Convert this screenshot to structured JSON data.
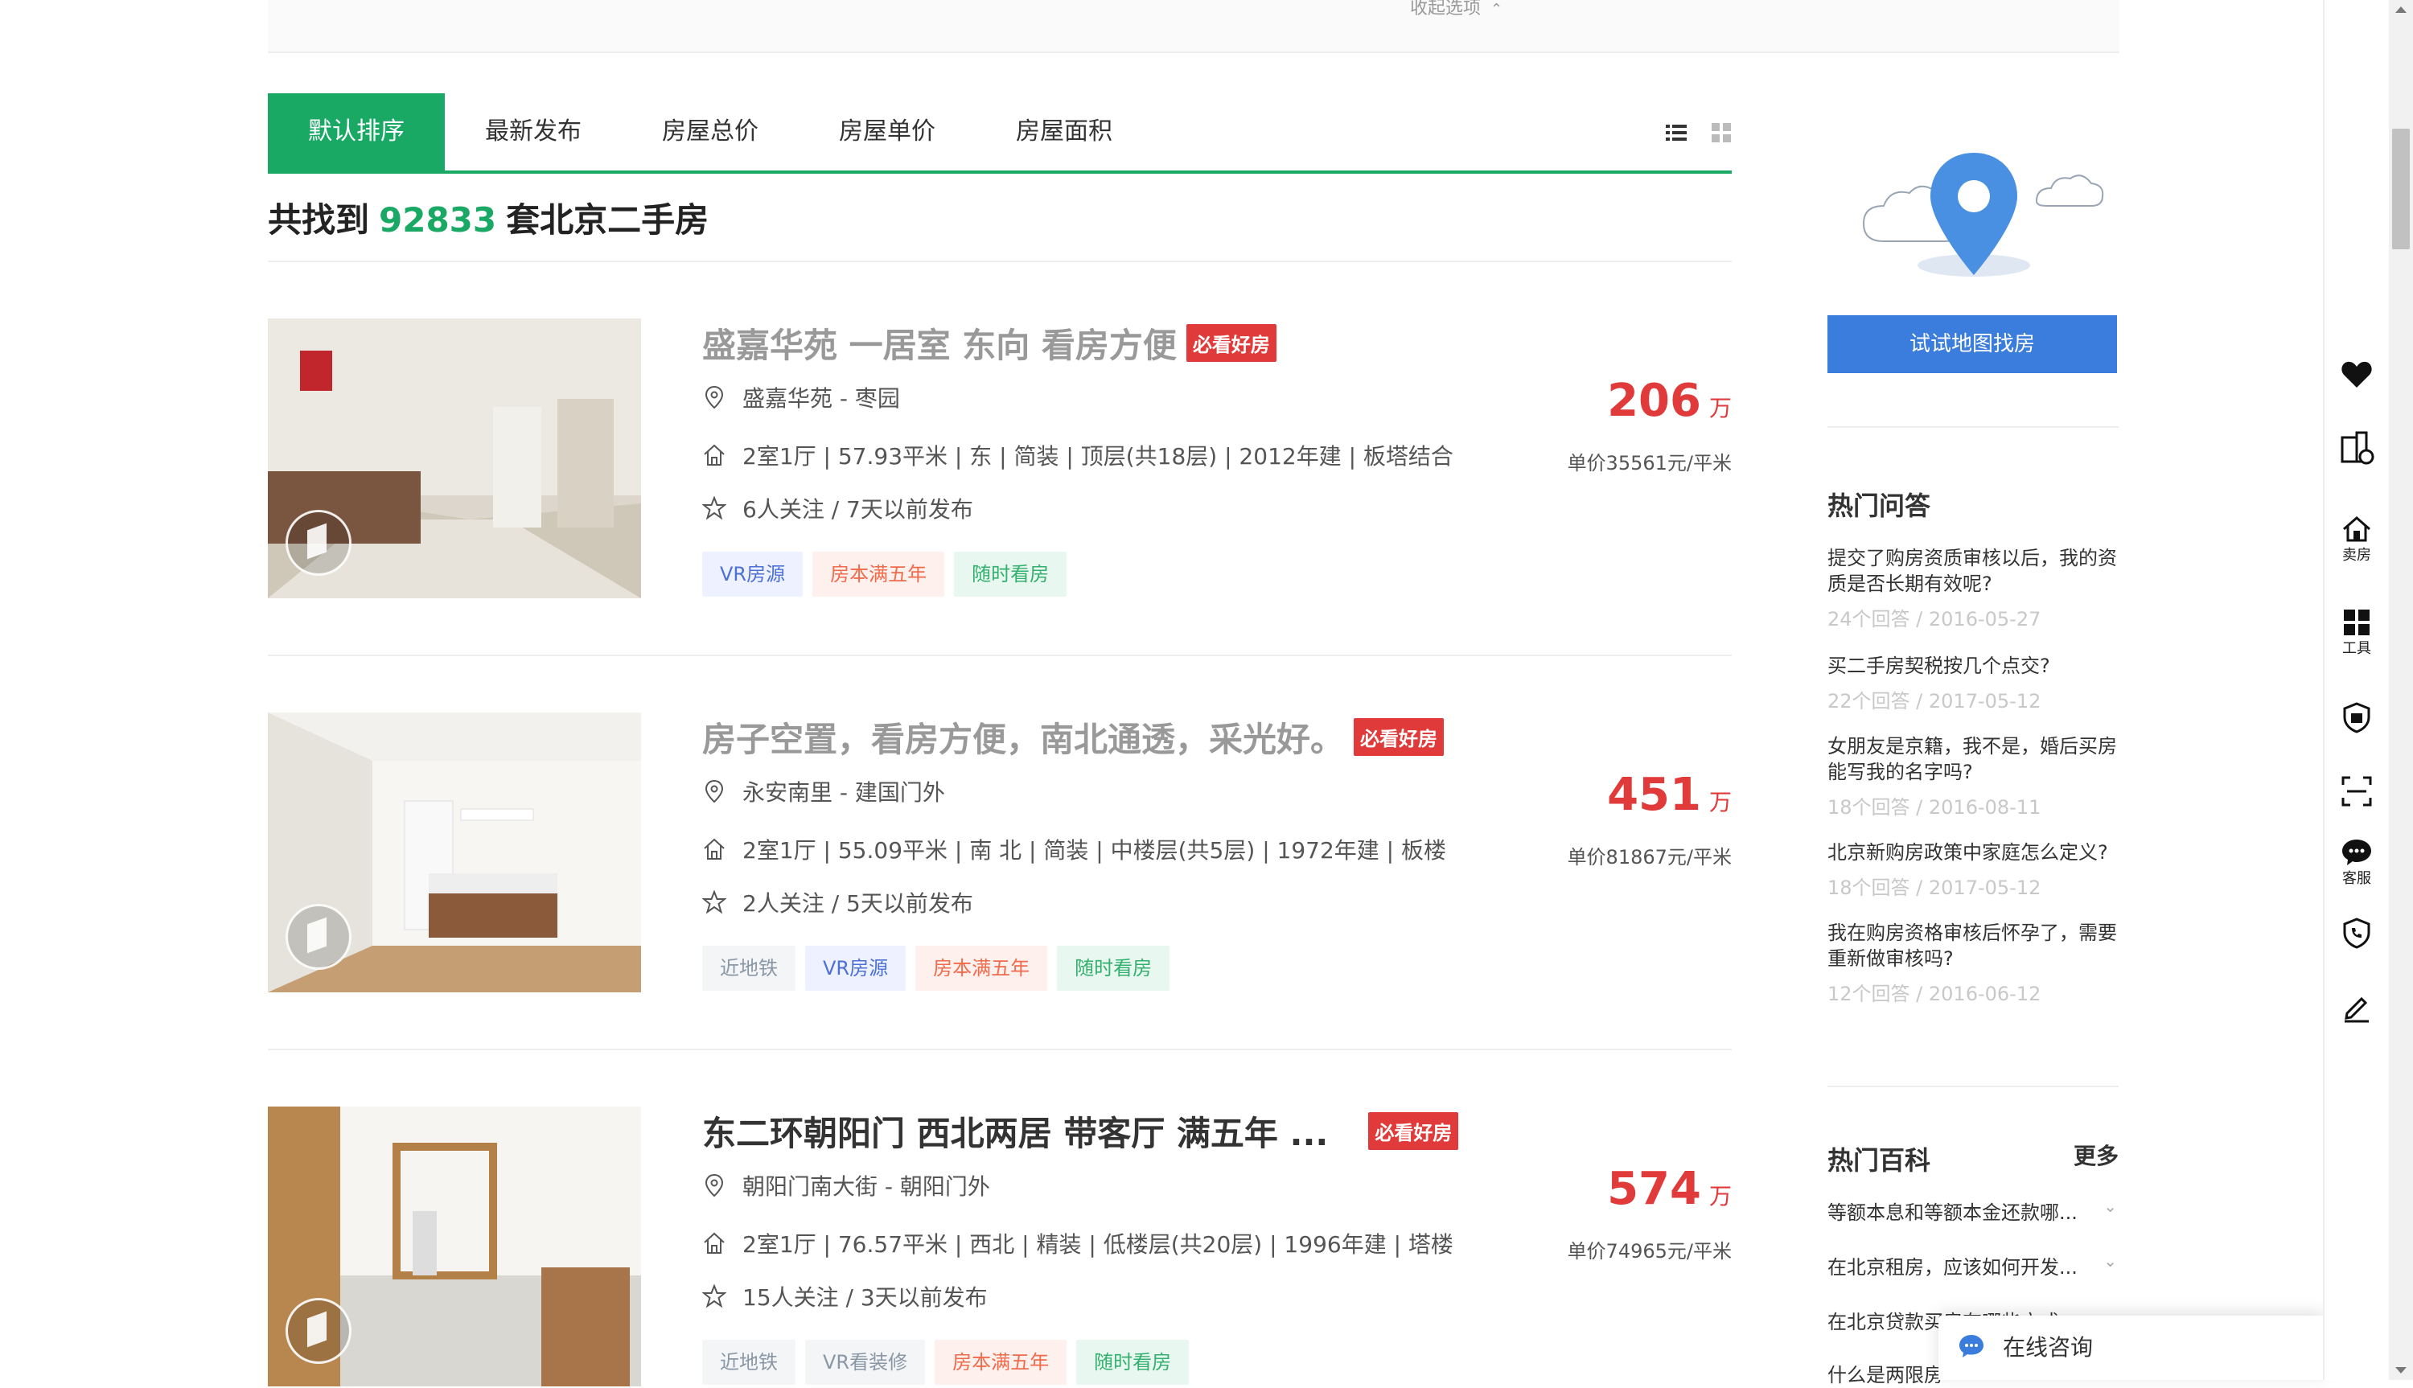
{
  "filters": {
    "collapse_label": "收起选项"
  },
  "sort_tabs": [
    {
      "label": "默认排序",
      "active": true
    },
    {
      "label": "最新发布",
      "active": false
    },
    {
      "label": "房屋总价",
      "active": false
    },
    {
      "label": "房屋单价",
      "active": false
    },
    {
      "label": "房屋面积",
      "active": false
    }
  ],
  "summary": {
    "prefix": "共找到",
    "count": "92833",
    "suffix": "套北京二手房"
  },
  "listings": [
    {
      "title": "盛嘉华苑 一居室 东向 看房方便",
      "badge": "必看好房",
      "location": "盛嘉华苑 - 枣园",
      "info": "2室1厅 | 57.93平米 | 东 | 简装 | 顶层(共18层) | 2012年建 | 板塔结合",
      "follow": "6人关注 / 7天以前发布",
      "tags": [
        "VR房源",
        "房本满五年",
        "随时看房"
      ],
      "price": "206",
      "price_unit": "万",
      "unit_price": "单价35561元/平米"
    },
    {
      "title": "房子空置，看房方便，南北通透，采光好。",
      "badge": "必看好房",
      "location": "永安南里 - 建国门外",
      "info": "2室1厅 | 55.09平米 | 南 北 | 简装 | 中楼层(共5层) | 1972年建 | 板楼",
      "follow": "2人关注 / 5天以前发布",
      "tags": [
        "近地铁",
        "VR房源",
        "房本满五年",
        "随时看房"
      ],
      "price": "451",
      "price_unit": "万",
      "unit_price": "单价81867元/平米"
    },
    {
      "title": "东二环朝阳门 西北两居 带客厅 满五年 ...",
      "badge": "必看好房",
      "location": "朝阳门南大街 - 朝阳门外",
      "info": "2室1厅 | 76.57平米 | 西北 | 精装 | 低楼层(共20层) | 1996年建 | 塔楼",
      "follow": "15人关注 / 3天以前发布",
      "tags": [
        "近地铁",
        "VR看装修",
        "房本满五年",
        "随时看房"
      ],
      "price": "574",
      "price_unit": "万",
      "unit_price": "单价74965元/平米"
    }
  ],
  "map_search": {
    "button": "试试地图找房"
  },
  "hot_qa": {
    "title": "热门问答",
    "items": [
      {
        "q": "提交了购房资质审核以后，我的资质是否长期有效呢?",
        "meta": "24个回答 / 2016-05-27"
      },
      {
        "q": "买二手房契税按几个点交?",
        "meta": "22个回答 / 2017-05-12"
      },
      {
        "q": "女朋友是京籍，我不是，婚后买房能写我的名字吗?",
        "meta": "18个回答 / 2016-08-11"
      },
      {
        "q": "北京新购房政策中家庭怎么定义?",
        "meta": "18个回答 / 2017-05-12"
      },
      {
        "q": "我在购房资格审核后怀孕了，需要重新做审核吗?",
        "meta": "12个回答 / 2016-06-12"
      }
    ]
  },
  "hot_wiki": {
    "title": "热门百科",
    "more": "更多",
    "items": [
      "等额本息和等额本金还款哪...",
      "在北京租房，应该如何开发...",
      "在北京贷款买房有哪些方式",
      "什么是两限房"
    ]
  },
  "chat": {
    "label": "在线咨询"
  },
  "sidebar": {
    "sell": "卖房",
    "tools": "工具",
    "service": "客服"
  }
}
